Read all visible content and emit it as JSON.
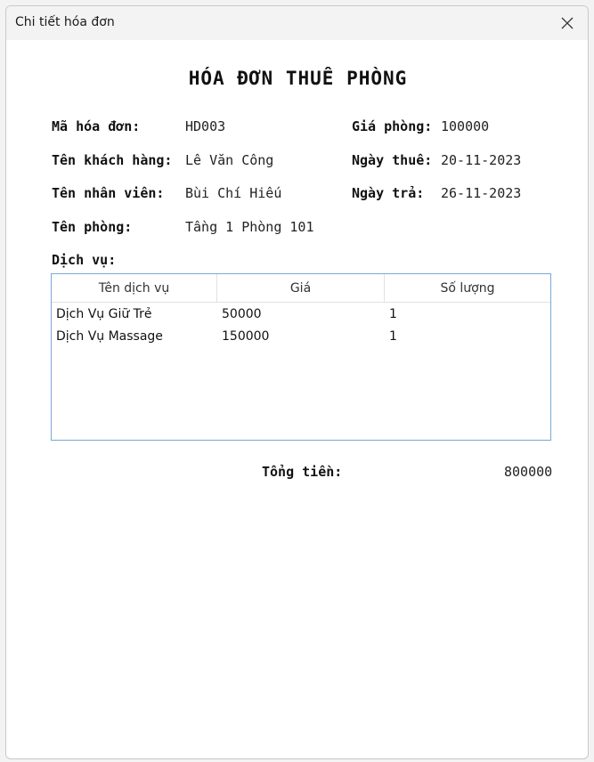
{
  "window": {
    "title": "Chi tiết hóa đơn"
  },
  "invoice": {
    "heading": "HÓA ĐƠN THUÊ PHÒNG",
    "fields": {
      "invoice_id": {
        "label": "Mã hóa đơn:",
        "value": "HD003"
      },
      "customer": {
        "label": "Tên khách hàng:",
        "value": "Lê Văn Công"
      },
      "staff": {
        "label": "Tên nhân viên:",
        "value": "Bùi Chí Hiếu"
      },
      "room": {
        "label": "Tên phòng:",
        "value": "Tầng 1 Phòng 101"
      },
      "room_price": {
        "label": "Giá phòng:",
        "value": "100000"
      },
      "checkin": {
        "label": "Ngày thuê:",
        "value": "20-11-2023"
      },
      "checkout": {
        "label": "Ngày trả:",
        "value": "26-11-2023"
      }
    },
    "services_label": "Dịch vụ:",
    "services_table": {
      "columns": [
        "Tên dịch vụ",
        "Giá",
        "Số lượng"
      ],
      "rows": [
        [
          "Dịch Vụ Giữ Trẻ",
          "50000",
          "1"
        ],
        [
          "Dịch Vụ Massage",
          "150000",
          "1"
        ]
      ]
    },
    "total": {
      "label": "Tổng tiền:",
      "value": "800000"
    }
  },
  "colors": {
    "grid_border": "#7aa7d6",
    "titlebar": "#f3f3f3"
  }
}
